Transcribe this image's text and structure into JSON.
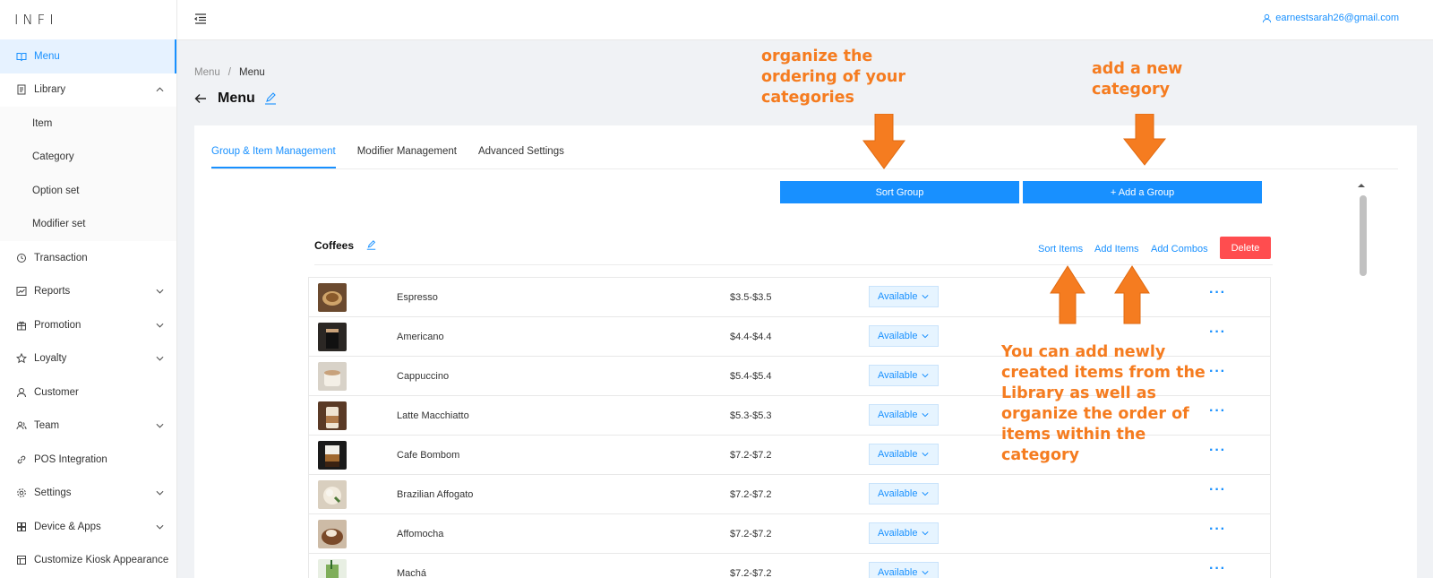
{
  "app": {
    "logo": "INFI"
  },
  "header": {
    "user_email": "earnestsarah26@gmail.com"
  },
  "sidebar": {
    "items": [
      {
        "label": "Menu",
        "icon": "book-icon",
        "active": true
      },
      {
        "label": "Library",
        "icon": "library-icon",
        "expanded": true
      },
      {
        "label": "Transaction",
        "icon": "transaction-icon"
      },
      {
        "label": "Reports",
        "icon": "chart-line-icon"
      },
      {
        "label": "Promotion",
        "icon": "gift-icon"
      },
      {
        "label": "Loyalty",
        "icon": "star-icon"
      },
      {
        "label": "Customer",
        "icon": "user-icon"
      },
      {
        "label": "Team",
        "icon": "team-icon"
      },
      {
        "label": "POS Integration",
        "icon": "link-icon"
      },
      {
        "label": "Settings",
        "icon": "gear-icon"
      },
      {
        "label": "Device & Apps",
        "icon": "apps-icon"
      },
      {
        "label": "Customize Kiosk Appearance",
        "icon": "layout-icon"
      }
    ],
    "library_sub": [
      "Item",
      "Category",
      "Option set",
      "Modifier set"
    ]
  },
  "breadcrumb": [
    "Menu",
    "Menu"
  ],
  "page": {
    "title": "Menu"
  },
  "tabs": [
    "Group & Item Management",
    "Modifier Management",
    "Advanced Settings"
  ],
  "actions": {
    "sort_group": "Sort Group",
    "add_group": "+ Add a Group"
  },
  "group": {
    "title": "Coffees",
    "sort_items": "Sort Items",
    "add_items": "Add Items",
    "add_combos": "Add Combos",
    "delete": "Delete"
  },
  "items": [
    {
      "name": "Espresso",
      "price": "$3.5-$3.5",
      "status": "Available"
    },
    {
      "name": "Americano",
      "price": "$4.4-$4.4",
      "status": "Available"
    },
    {
      "name": "Cappuccino",
      "price": "$5.4-$5.4",
      "status": "Available"
    },
    {
      "name": "Latte Macchiatto",
      "price": "$5.3-$5.3",
      "status": "Available"
    },
    {
      "name": "Cafe Bombom",
      "price": "$7.2-$7.2",
      "status": "Available"
    },
    {
      "name": "Brazilian Affogato",
      "price": "$7.2-$7.2",
      "status": "Available"
    },
    {
      "name": "Affomocha",
      "price": "$7.2-$7.2",
      "status": "Available"
    },
    {
      "name": "Machá",
      "price": "$7.2-$7.2",
      "status": "Available"
    }
  ],
  "annotations": {
    "sort_group": "organize the\nordering of your\ncategories",
    "add_group": "add a new\ncategory",
    "items": "You can add newly\ncreated items from the\nLibrary as well as\norganize the order of\nitems within the\ncategory"
  },
  "colors": {
    "accent": "#1890ff",
    "danger": "#ff4d4f",
    "annotation": "#f57c20"
  }
}
